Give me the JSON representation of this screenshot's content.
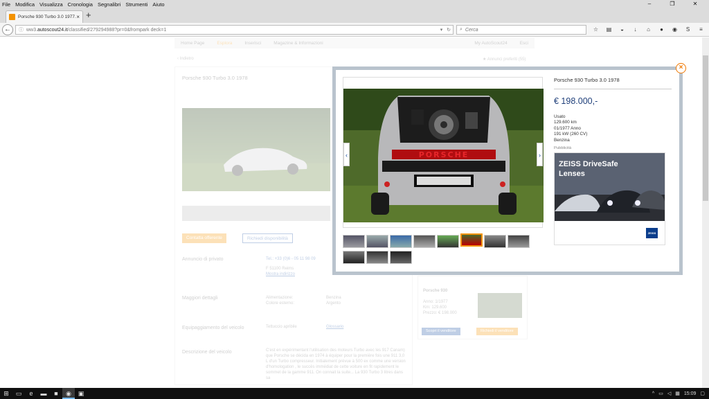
{
  "menu": [
    "File",
    "Modifica",
    "Visualizza",
    "Cronologia",
    "Segnalibri",
    "Strumenti",
    "Aiuto"
  ],
  "window": {
    "min": "–",
    "max": "❐",
    "close": "✕"
  },
  "tab": {
    "title": "Porsche 930 Turbo 3.0 1977...",
    "close": "×",
    "new": "+"
  },
  "nav": {
    "url_prefix": "ww3.",
    "url_host": "autoscout24.it",
    "url_path": "/classified/279294988?pr=0&frompark deck=1",
    "search_placeholder": "Cerca"
  },
  "site_nav": [
    "Home Page",
    "Esplora",
    "Inserisci",
    "Magazine & Informazioni",
    "My AutoScout24",
    "Esci"
  ],
  "breadcrumb": "‹ Indietro",
  "favorites": "Annunci preferiti (55)",
  "listing": {
    "title": "Porsche 930 Turbo 3.0 1978",
    "contact_btn": "Contatta offerente",
    "avail_btn": "Richiedi disponibilità",
    "seller_section": "Annuncio di privato",
    "phone": "Tel.: +33 (0)6 - 05 11 98 09",
    "location": "F 51100 Reims",
    "map_link": "Mostra indirizzo",
    "details_section": "Maggiori dettagli",
    "fuel_label": "Alimentazione:",
    "fuel": "Benzina",
    "color_label": "Colore esterno:",
    "color": "Argento",
    "equip_section": "Equipaggiamento del veicolo",
    "equip": "Tettuccio apribile",
    "glossary": "Glossario",
    "desc_section": "Descrizione del veicolo",
    "desc": "C'est en expérimentant l'utilisation des moteurs Turbo avec les 917 Canam) que Porsche se décida en 1974 à équiper pour la première fois une 911 3,0 L d'un Turbo compresseur. Initialement prévue à 500 ex comme une version d'homologation , le succès immédiat de cette voiture en fit rapidement le sommet de la gamme 911. On connait la suite... La 930 Turbo 3 litres dans sa"
  },
  "similar": {
    "name": "Porsche 930",
    "year": "Anno: 1/1977",
    "km": "Km: 129.600",
    "price": "Prezzo: € 198.000",
    "btn1": "Scopri il venditore",
    "btn2": "Richiedi il venditore"
  },
  "modal": {
    "close": "×",
    "title": "Porsche 930 Turbo 3.0 1978",
    "price": "€ 198.000,-",
    "details": [
      "Usato",
      "129.600 km",
      "01/1977 Anno",
      "191 kW (260 CV)",
      "Benzina"
    ],
    "ad_label": "Pubblicità",
    "ad_text": "ZEISS DriveSafe Lenses",
    "ad_logo": "ZEISS",
    "prev": "‹",
    "next": "›",
    "plate": "PORSCHE"
  },
  "taskbar": {
    "time": "15:09"
  }
}
